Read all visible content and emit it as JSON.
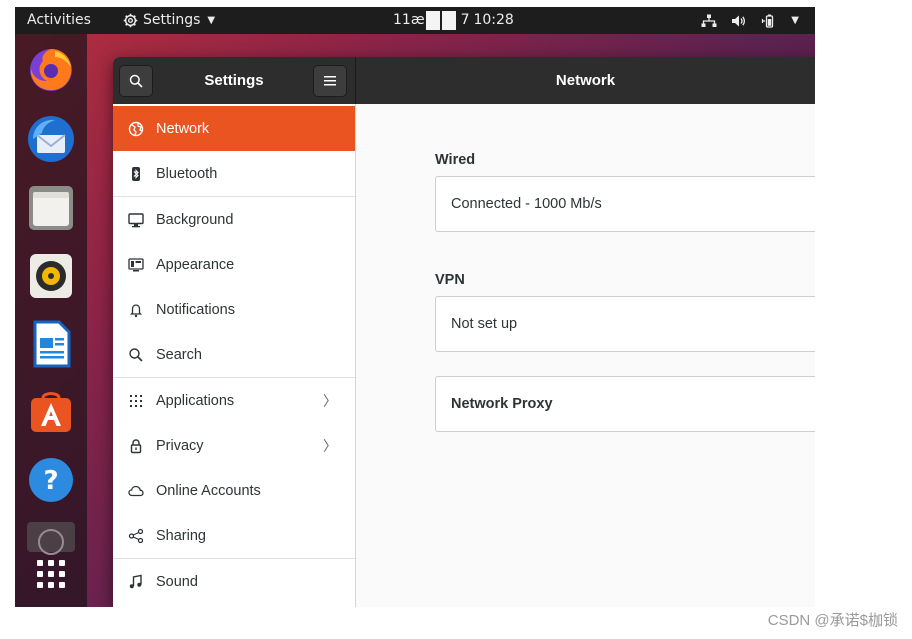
{
  "topbar": {
    "activities": "Activities",
    "app_name": "Settings",
    "clock_prefix": "11æ",
    "clock_day": "7",
    "clock_time": "10:28"
  },
  "dock": {
    "items": [
      "firefox-icon",
      "thunderbird-icon",
      "files-icon",
      "rhythmbox-icon",
      "libreoffice-writer-icon",
      "software-center-icon",
      "help-icon",
      "show-applications-icon"
    ]
  },
  "window": {
    "sidebar_title": "Settings",
    "page_title": "Network"
  },
  "sidebar": {
    "items": [
      {
        "label": "Network",
        "icon": "globe-icon",
        "active": true
      },
      {
        "label": "Bluetooth",
        "icon": "bluetooth-icon"
      },
      {
        "label": "Background",
        "icon": "display-icon"
      },
      {
        "label": "Appearance",
        "icon": "appearance-icon"
      },
      {
        "label": "Notifications",
        "icon": "bell-icon"
      },
      {
        "label": "Search",
        "icon": "search-icon"
      },
      {
        "label": "Applications",
        "icon": "grid-icon",
        "has_submenu": true
      },
      {
        "label": "Privacy",
        "icon": "lock-icon",
        "has_submenu": true
      },
      {
        "label": "Online Accounts",
        "icon": "cloud-icon"
      },
      {
        "label": "Sharing",
        "icon": "share-icon"
      },
      {
        "label": "Sound",
        "icon": "music-note-icon"
      }
    ]
  },
  "content": {
    "wired_title": "Wired",
    "wired_status": "Connected - 1000 Mb/s",
    "vpn_title": "VPN",
    "vpn_status": "Not set up",
    "proxy_label": "Network Proxy"
  },
  "colors": {
    "accent": "#e95420",
    "topbar": "#1d1d1d",
    "headerbar": "#2d2d2d"
  },
  "watermark": "CSDN @承诺$枷锁"
}
